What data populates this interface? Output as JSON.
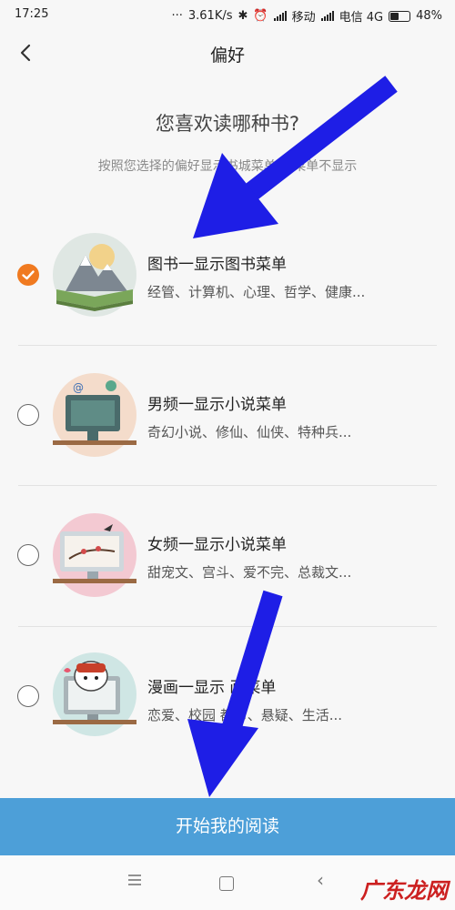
{
  "status_bar": {
    "time": "17:25",
    "speed": "3.61K/s",
    "carrier1": "移动",
    "carrier2": "电信 4G",
    "battery": "48%"
  },
  "header": {
    "title": "偏好"
  },
  "intro": {
    "question": "您喜欢读哪种书?",
    "subtitle": "按照您选择的偏好显示书城菜单    选菜单不显示"
  },
  "options": [
    {
      "label": "图书一显示图书菜单",
      "desc": "经管、计算机、心理、哲学、健康...",
      "selected": true,
      "icon": "book-landscape-icon"
    },
    {
      "label": "男频一显示小说菜单",
      "desc": "奇幻小说、修仙、仙侠、特种兵...",
      "selected": false,
      "icon": "computer-chat-icon"
    },
    {
      "label": "女频一显示小说菜单",
      "desc": "甜宠文、宫斗、爱不完、总裁文...",
      "selected": false,
      "icon": "monitor-birds-icon"
    },
    {
      "label": "漫画一显示  画菜单",
      "desc": "恋爱、校园  都市、悬疑、生活...",
      "selected": false,
      "icon": "monitor-cartoon-icon"
    }
  ],
  "start_button": {
    "label": "开始我的阅读"
  },
  "watermark": {
    "text": "广东龙网"
  },
  "colors": {
    "accent": "#f07a20",
    "button": "#4d9fd8",
    "arrow": "#1e1ee6"
  }
}
